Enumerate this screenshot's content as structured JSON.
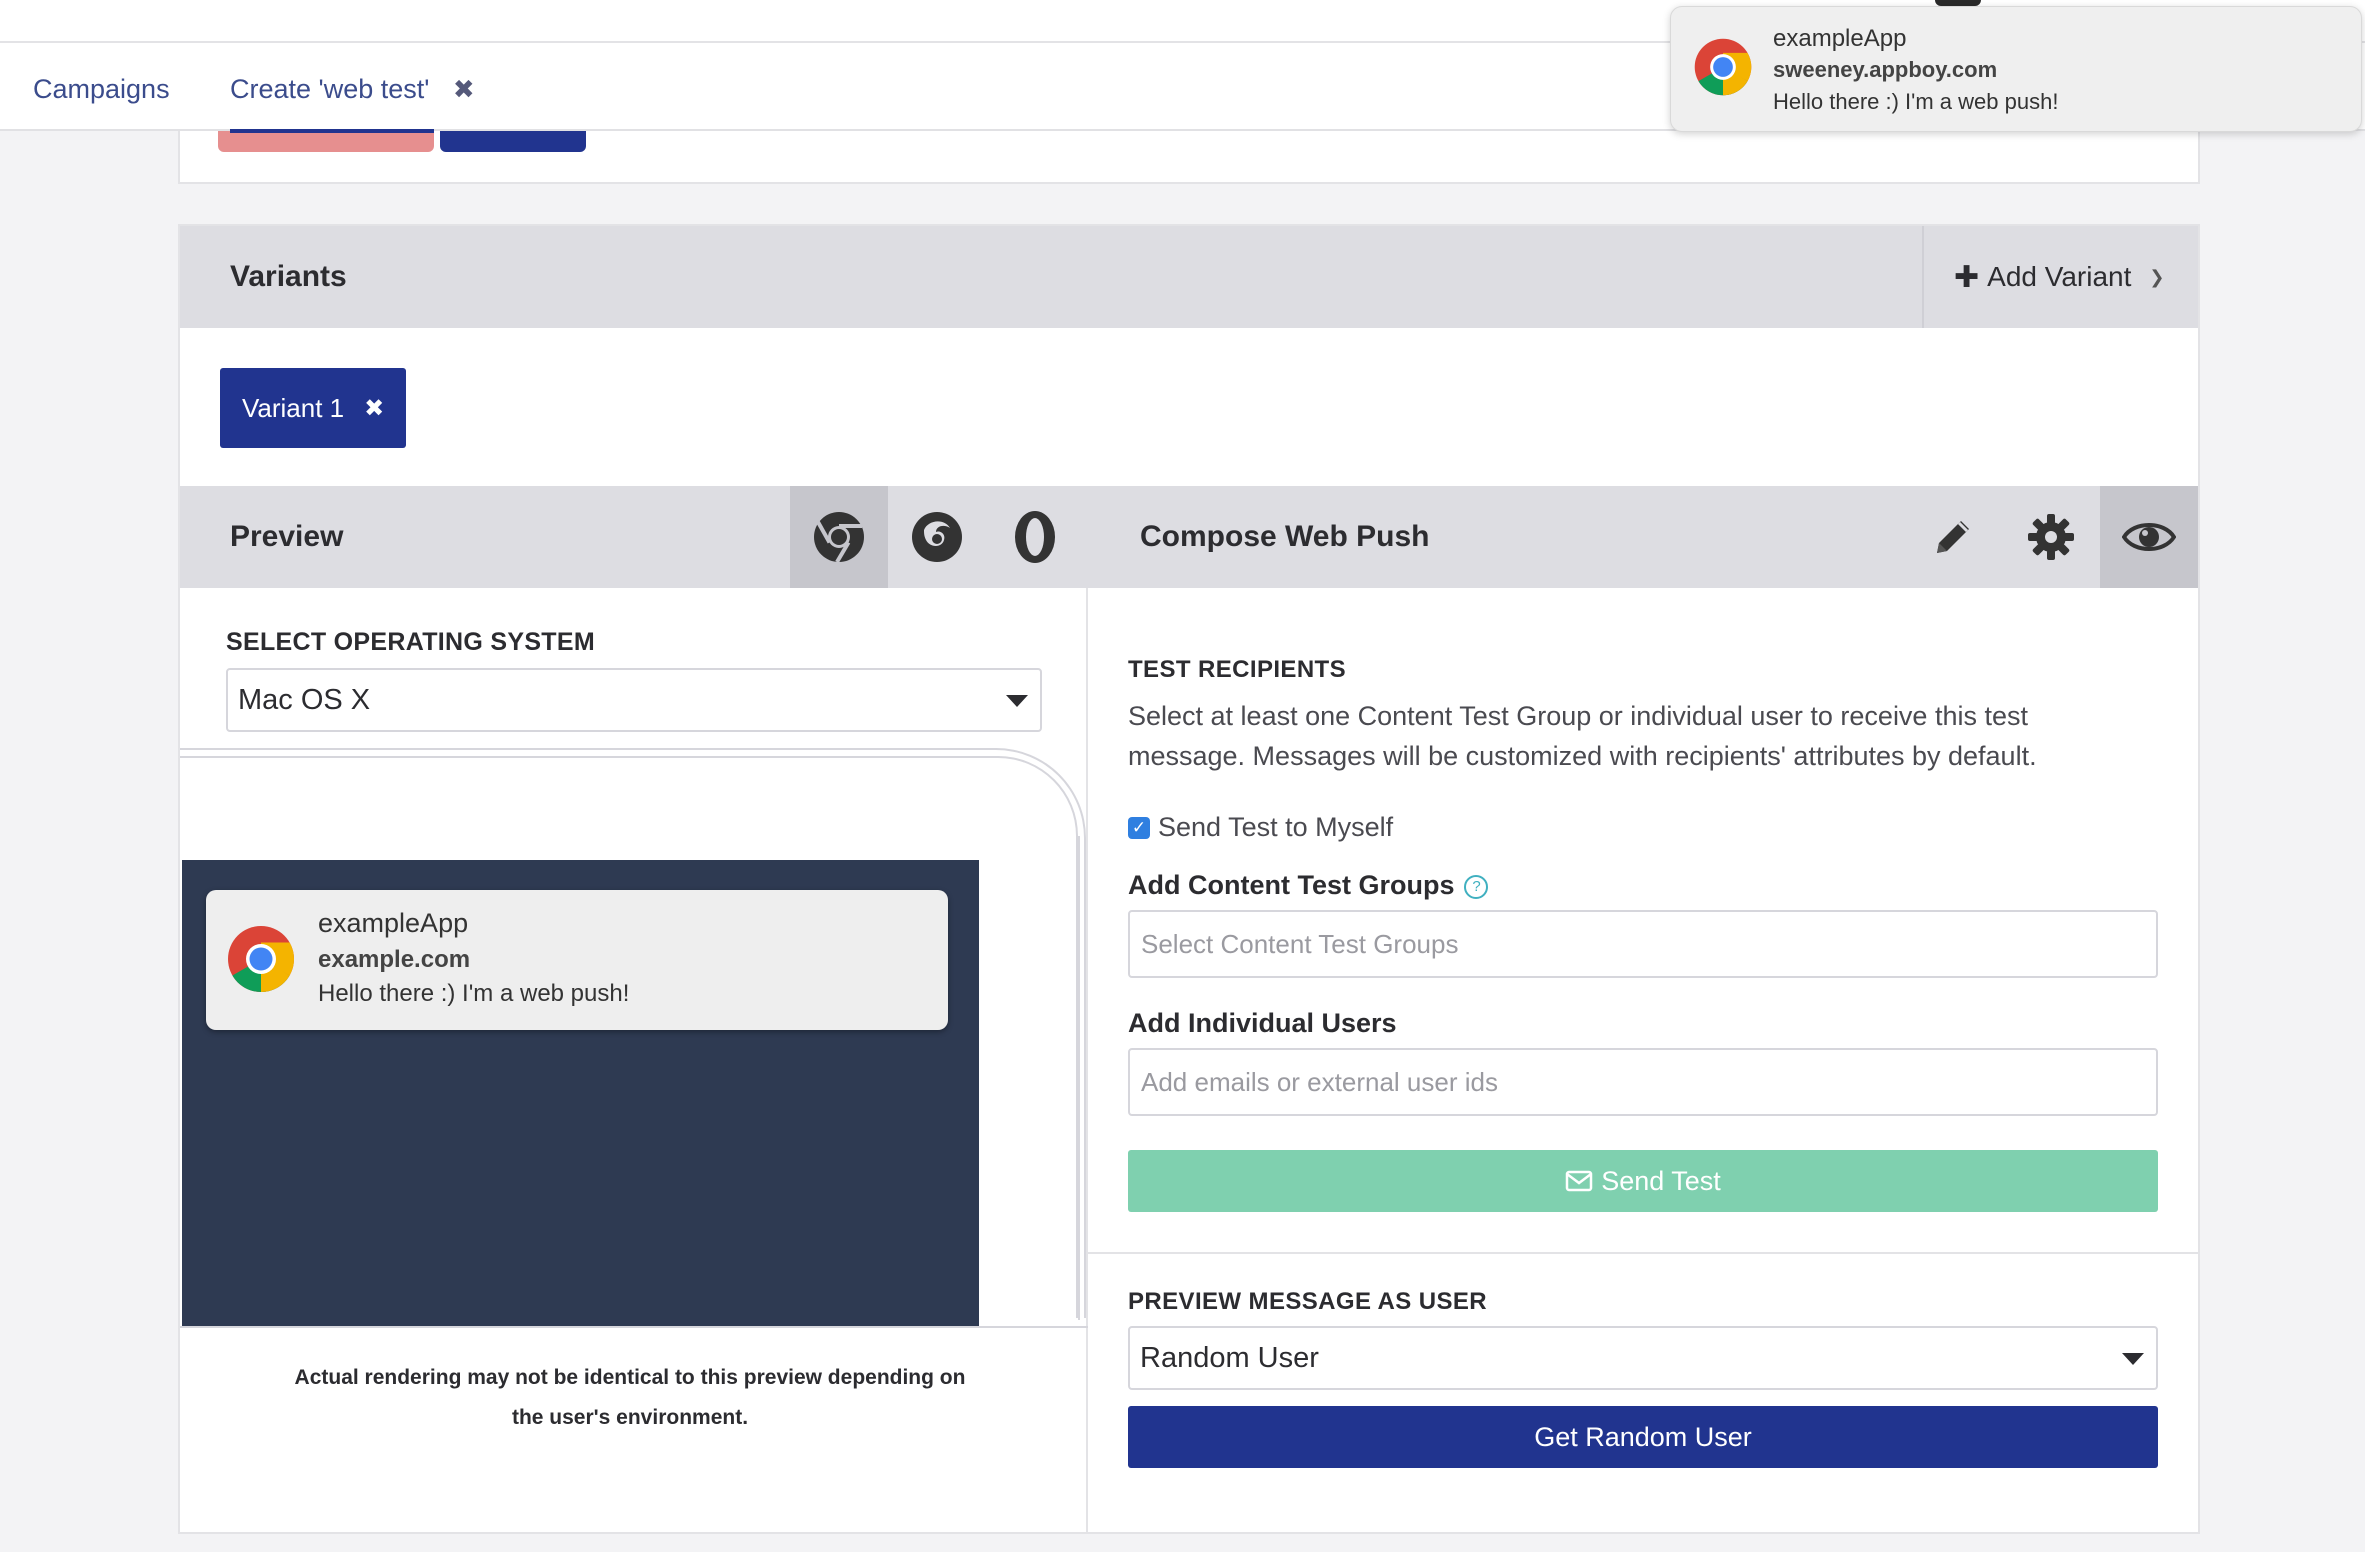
{
  "tabs": {
    "campaigns": "Campaigns",
    "create": "Create 'web test'",
    "close_glyph": "✖"
  },
  "variants": {
    "title": "Variants",
    "add_label": "Add Variant",
    "add_glyph": "✚",
    "tab_label": "Variant 1",
    "tab_close": "✖"
  },
  "preview": {
    "title": "Preview",
    "browsers": [
      "chrome-icon",
      "firefox-icon",
      "opera-icon"
    ],
    "selected_browser": "chrome-icon"
  },
  "compose": {
    "title": "Compose Web Push",
    "tools": [
      "pencil-icon",
      "gear-icon",
      "eye-icon"
    ],
    "selected_tool": "eye-icon"
  },
  "os": {
    "label": "SELECT OPERATING SYSTEM",
    "value": "Mac OS X"
  },
  "preview_notification": {
    "app": "exampleApp",
    "site": "example.com",
    "body": "Hello there :) I'm a web push!"
  },
  "disclaimer": {
    "line1": "Actual rendering may not be identical to this preview depending on",
    "line2": "the user's environment."
  },
  "test_recipients": {
    "label": "TEST RECIPIENTS",
    "description": "Select at least one Content Test Group or individual user to receive this test message. Messages will be customized with recipients' attributes by default.",
    "send_to_self": "Send Test to Myself",
    "send_to_self_checked": true,
    "content_groups_label": "Add Content Test Groups",
    "content_groups_placeholder": "Select Content Test Groups",
    "individual_users_label": "Add Individual Users",
    "individual_users_placeholder": "Add emails or external user ids",
    "send_test_label": "Send Test"
  },
  "preview_as_user": {
    "label": "PREVIEW MESSAGE AS USER",
    "value": "Random User",
    "button": "Get Random User"
  },
  "system_notification": {
    "app": "exampleApp",
    "site": "sweeney.appboy.com",
    "body": "Hello there :) I'm a web push!"
  },
  "colors": {
    "brand_navy": "#21348f",
    "send_test_green": "#7fd0af",
    "header_gray": "#dddde2",
    "screen_dark": "#2e3a52"
  }
}
